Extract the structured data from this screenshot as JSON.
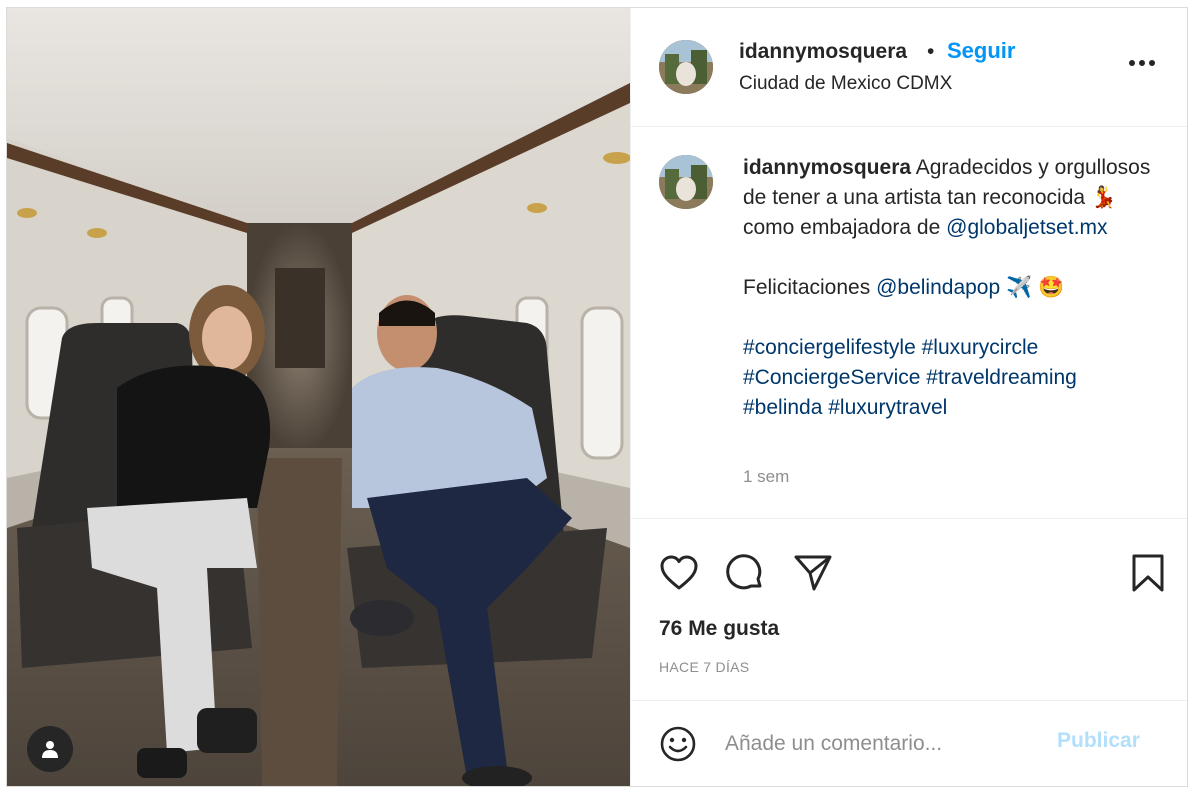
{
  "post": {
    "author": {
      "username": "idannymosquera",
      "location": "Ciudad de Mexico CDMX",
      "follow_label": "Seguir",
      "separator": "•"
    },
    "caption": {
      "username": "idannymosquera",
      "line1": "Agradecidos y orgullosos de tener a una artista tan reconocida",
      "emoji1": "💃",
      "line1_tail": "como embajadora de",
      "mention1": "@globaljetset.mx",
      "line2": "Felicitaciones",
      "mention2": "@belindapop",
      "emoji2": "✈️",
      "emoji3": "🤩",
      "hashtags_line1": [
        "#conciergelifestyle",
        "#luxurycircle"
      ],
      "hashtags_line2": [
        "#ConciergeService",
        "#traveldreaming"
      ],
      "hashtags_line3": [
        "#belinda",
        "#luxurytravel"
      ],
      "time_ago": "1 sem"
    },
    "likes": "76 Me gusta",
    "date": "HACE 7 DÍAS",
    "comment": {
      "placeholder": "Añade un comentario...",
      "publish_label": "Publicar"
    },
    "icons": {
      "more": "more-options-icon",
      "like": "heart-icon",
      "comment": "comment-icon",
      "share": "send-icon",
      "save": "bookmark-icon",
      "emoji": "emoji-icon",
      "tagged": "user-tag-icon"
    },
    "colors": {
      "accent": "#0095f6",
      "link": "#00376b",
      "muted": "#8e8e8e",
      "publish_disabled": "#b2dffc"
    }
  }
}
